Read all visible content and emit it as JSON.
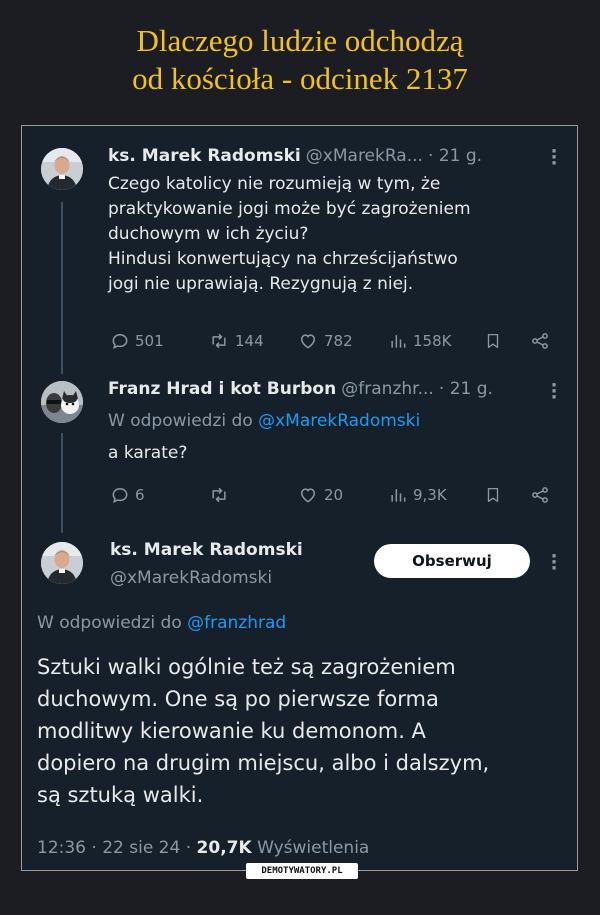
{
  "page": {
    "title_line1": "Dlaczego ludzie odchodzą",
    "title_line2": "od kościoła - odcinek 2137",
    "watermark": "DEMOTYWATORY.PL"
  },
  "tweet1": {
    "name": "ks. Marek Radomski",
    "handle": "@xMarekRa...",
    "time": "· 21 g.",
    "lines": [
      "Czego katolicy nie rozumieją w tym, że",
      "praktykowanie jogi może być zagrożeniem",
      "duchowym w ich życiu?",
      "Hindusi konwertujący na chrześcijaństwo",
      "jogi nie uprawiają. Rezygnują z niej."
    ],
    "replies": "501",
    "retweets": "144",
    "likes": "782",
    "views": "158K"
  },
  "tweet2": {
    "name": "Franz Hrad i kot Burbon",
    "handle": "@franzhr...",
    "time": "· 21 g.",
    "reply_prefix": "W odpowiedzi do",
    "reply_to": "@xMarekRadomski",
    "text": "a karate?",
    "replies": "6",
    "retweets": "",
    "likes": "20",
    "views": "9,3K"
  },
  "tweet3": {
    "name": "ks. Marek Radomski",
    "handle": "@xMarekRadomski",
    "follow_label": "Obserwuj",
    "reply_prefix": "W odpowiedzi do",
    "reply_to": "@franzhrad",
    "lines": [
      "Sztuki walki ogólnie też są zagrożeniem",
      "duchowym. One są po pierwsze forma",
      "modlitwy kierowanie ku demonom. A",
      "dopiero na drugim miejscu, albo i dalszym,",
      "są sztuką walki."
    ],
    "meta_time": "12:36 · 22 sie 24 ·",
    "meta_views": "20,7K",
    "meta_views_label": "Wyświetlenia"
  },
  "colors": {
    "page_background": "#1c1d23",
    "headline": "#f2c21b",
    "tweet_background": "#15202b",
    "text": "#e7e9ea",
    "muted": "#8b98a5",
    "link": "#1d9bf0"
  },
  "icons": [
    "more-options-icon",
    "reply-icon",
    "retweet-icon",
    "like-icon",
    "views-icon",
    "bookmark-icon",
    "share-icon"
  ]
}
